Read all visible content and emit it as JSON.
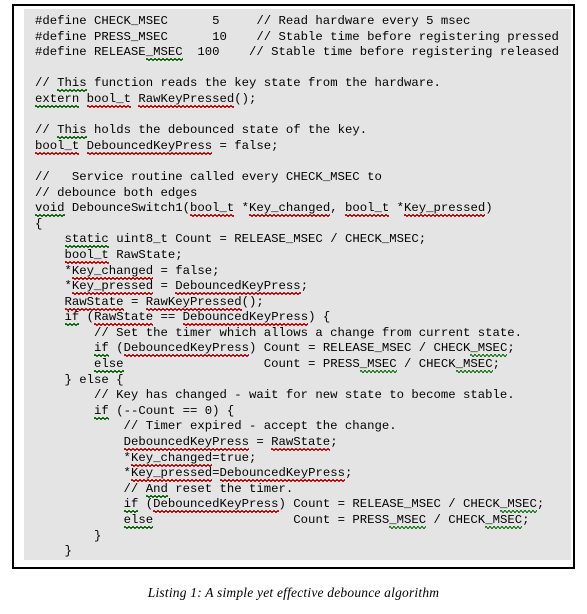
{
  "document": {
    "type": "code-listing-figure",
    "language": "C",
    "caption": "Listing 1: A simple yet effective debounce algorithm",
    "colors": {
      "page_background": "#ffffff",
      "code_background": "#e4e4e4",
      "frame_border": "#000000",
      "text": "#000000",
      "spelling_squiggle": "#d81818",
      "grammar_squiggle": "#1c7a1c"
    }
  },
  "code": {
    "lines": [
      "#define CHECK_MSEC      5     // Read hardware every 5 msec",
      "#define PRESS_MSEC      10    // Stable time before registering pressed",
      "#define RELEASE_MSEC  100    // Stable time before registering released",
      "",
      "// This function reads the key state from the hardware.",
      "extern bool_t RawKeyPressed();",
      "",
      "// This holds the debounced state of the key.",
      "bool_t DebouncedKeyPress = false;",
      "",
      "//   Service routine called every CHECK_MSEC to",
      "// debounce both edges",
      "void DebounceSwitch1(bool_t *Key_changed, bool_t *Key_pressed)",
      "{",
      "    static uint8_t Count = RELEASE_MSEC / CHECK_MSEC;",
      "    bool_t RawState;",
      "    *Key_changed = false;",
      "    *Key_pressed = DebouncedKeyPress;",
      "    RawState = RawKeyPressed();",
      "    if (RawState == DebouncedKeyPress) {",
      "        // Set the timer which allows a change from current state.",
      "        if (DebouncedKeyPress) Count = RELEASE_MSEC / CHECK_MSEC;",
      "        else                   Count = PRESS_MSEC / CHECK_MSEC;",
      "    } else {",
      "        // Key has changed - wait for new state to become stable.",
      "        if (--Count == 0) {",
      "            // Timer expired - accept the change.",
      "            DebouncedKeyPress = RawState;",
      "            *Key_changed=true;",
      "            *Key_pressed=DebouncedKeyPress;",
      "            // And reset the timer.",
      "            if (DebouncedKeyPress) Count = RELEASE_MSEC / CHECK_MSEC;",
      "            else                   Count = PRESS_MSEC / CHECK_MSEC;",
      "        }",
      "    }",
      "}"
    ],
    "line_count": 35,
    "defines": [
      {
        "name": "CHECK_MSEC",
        "value": "5",
        "comment": "// Read hardware every 5 msec"
      },
      {
        "name": "PRESS_MSEC",
        "value": "10",
        "comment": "// Stable time before registering pressed"
      },
      {
        "name": "RELEASE_MSEC",
        "value": "100",
        "comment": "// Stable time before registering released"
      }
    ],
    "functions": [
      {
        "signature": "extern bool_t RawKeyPressed();",
        "kind": "declaration"
      },
      {
        "signature": "void DebounceSwitch1(bool_t *Key_changed, bool_t *Key_pressed)",
        "kind": "definition"
      }
    ],
    "globals": [
      {
        "declaration": "bool_t DebouncedKeyPress = false;"
      }
    ]
  },
  "caption": {
    "text": "Listing 1: A simple yet effective debounce algorithm"
  }
}
